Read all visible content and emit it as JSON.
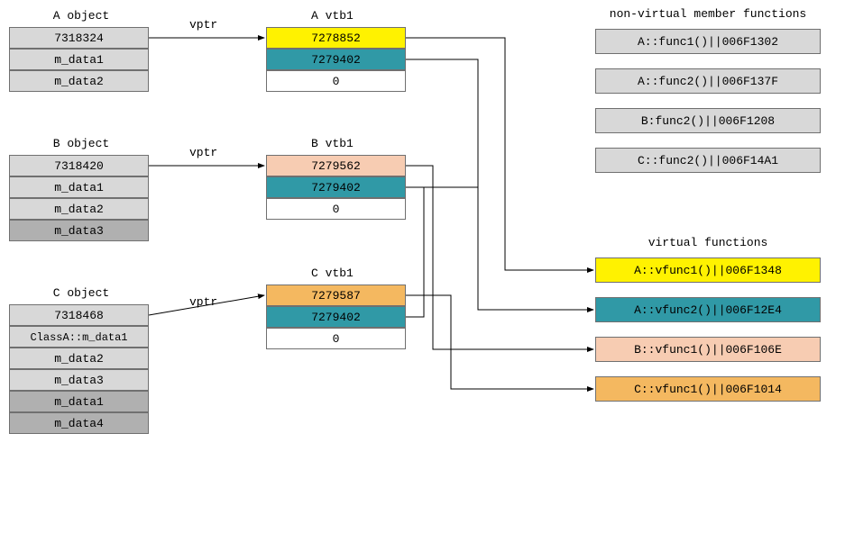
{
  "objects": {
    "a": {
      "title": "A object",
      "vptr_label": "vptr",
      "rows": [
        "7318324",
        "m_data1",
        "m_data2"
      ]
    },
    "b": {
      "title": "B object",
      "vptr_label": "vptr",
      "rows": [
        "7318420",
        "m_data1",
        "m_data2",
        "m_data3"
      ]
    },
    "c": {
      "title": "C object",
      "vptr_label": "vptr",
      "rows": [
        "7318468",
        "ClassA::m_data1",
        "m_data2",
        "m_data3",
        "m_data1",
        "m_data4"
      ]
    }
  },
  "vtbls": {
    "a": {
      "title": "A vtb1",
      "rows": [
        "7278852",
        "7279402",
        "0"
      ]
    },
    "b": {
      "title": "B vtb1",
      "rows": [
        "7279562",
        "7279402",
        "0"
      ]
    },
    "c": {
      "title": "C vtb1",
      "rows": [
        "7279587",
        "7279402",
        "0"
      ]
    }
  },
  "nonvirtual": {
    "title": "non-virtual member functions",
    "items": [
      "A::func1()||006F1302",
      "A::func2()||006F137F",
      "B:func2()||006F1208",
      "C::func2()||006F14A1"
    ]
  },
  "virtual": {
    "title": "virtual functions",
    "items": [
      "A::vfunc1()||006F1348",
      "A::vfunc2()||006F12E4",
      "B::vfunc1()||006F106E",
      "C::vfunc1()||006F1014"
    ]
  }
}
